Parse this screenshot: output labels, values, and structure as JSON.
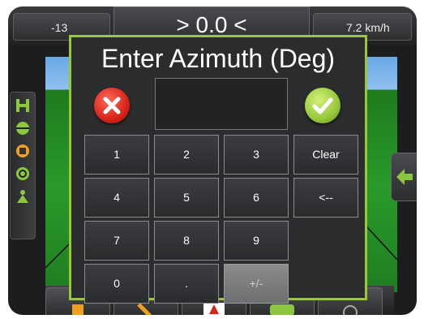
{
  "status_bar": {
    "left_value": "-13",
    "center_value": "> 0.0 <",
    "right_value": "7.2 km/h"
  },
  "dialog": {
    "title": "Enter Azimuth (Deg)",
    "display_value": "",
    "keys": [
      "1",
      "2",
      "3",
      "Clear",
      "4",
      "5",
      "6",
      "<--",
      "7",
      "8",
      "9",
      "0",
      ".",
      "+/-"
    ],
    "disabled_key": "+/-"
  },
  "icons": {
    "cancel": "x-icon",
    "confirm": "check-icon",
    "right_tab": "arrow-left-icon"
  },
  "colors": {
    "dialog_border": "#9ac63a",
    "cancel": "#d8241a",
    "confirm": "#96c93a"
  }
}
